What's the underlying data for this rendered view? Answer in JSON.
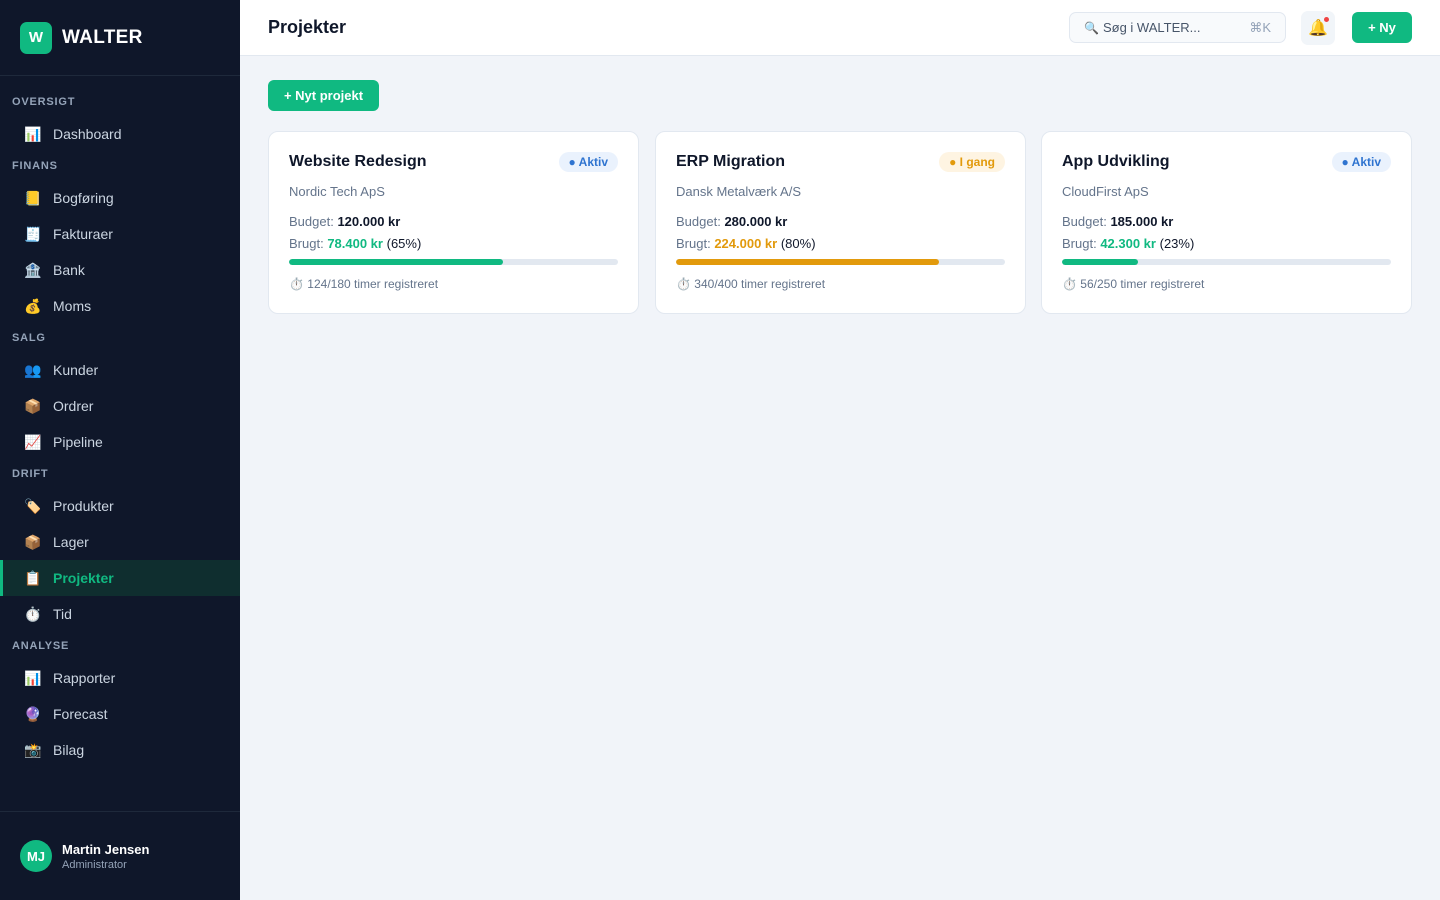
{
  "brand": {
    "logo_letter": "W",
    "name": "WALTER"
  },
  "sidebar": {
    "sections": [
      {
        "label": "OVERSIGT",
        "items": [
          {
            "label": "Dashboard",
            "icon": "📊",
            "icon_name": "chart-icon"
          }
        ]
      },
      {
        "label": "FINANS",
        "items": [
          {
            "label": "Bogføring",
            "icon": "📒",
            "icon_name": "ledger-icon"
          },
          {
            "label": "Fakturaer",
            "icon": "🧾",
            "icon_name": "receipt-icon"
          },
          {
            "label": "Bank",
            "icon": "🏦",
            "icon_name": "bank-icon"
          },
          {
            "label": "Moms",
            "icon": "💰",
            "icon_name": "money-bag-icon"
          }
        ]
      },
      {
        "label": "SALG",
        "items": [
          {
            "label": "Kunder",
            "icon": "👥",
            "icon_name": "users-icon"
          },
          {
            "label": "Ordrer",
            "icon": "📦",
            "icon_name": "package-icon"
          },
          {
            "label": "Pipeline",
            "icon": "📈",
            "icon_name": "trend-icon"
          }
        ]
      },
      {
        "label": "DRIFT",
        "items": [
          {
            "label": "Produkter",
            "icon": "🏷️",
            "icon_name": "tag-icon"
          },
          {
            "label": "Lager",
            "icon": "📦",
            "icon_name": "package-icon"
          },
          {
            "label": "Projekter",
            "icon": "📋",
            "icon_name": "clipboard-icon",
            "active": true
          },
          {
            "label": "Tid",
            "icon": "⏱️",
            "icon_name": "stopwatch-icon"
          }
        ]
      },
      {
        "label": "ANALYSE",
        "items": [
          {
            "label": "Rapporter",
            "icon": "📊",
            "icon_name": "chart-icon"
          },
          {
            "label": "Forecast",
            "icon": "🔮",
            "icon_name": "crystal-ball-icon"
          },
          {
            "label": "Bilag",
            "icon": "📸",
            "icon_name": "camera-icon"
          }
        ]
      }
    ]
  },
  "user": {
    "initials": "MJ",
    "name": "Martin Jensen",
    "role": "Administrator"
  },
  "header": {
    "title": "Projekter",
    "search_placeholder": "Søg i WALTER...",
    "search_shortcut": "⌘K",
    "new_label": "+ Ny"
  },
  "main": {
    "new_project_label": "+ Nyt projekt",
    "projects": [
      {
        "name": "Website Redesign",
        "status": "● Aktiv",
        "status_color": "blue",
        "client": "Nordic Tech ApS",
        "budget_label": "Budget:",
        "budget": "120.000 kr",
        "used_label": "Brugt:",
        "used": "78.400 kr",
        "used_pct": "(65%)",
        "progress": 0.65,
        "color": "#10b981",
        "hours": "124/180 timer registreret"
      },
      {
        "name": "ERP Migration",
        "status": "● I gang",
        "status_color": "amber",
        "client": "Dansk Metalværk A/S",
        "budget_label": "Budget:",
        "budget": "280.000 kr",
        "used_label": "Brugt:",
        "used": "224.000 kr",
        "used_pct": "(80%)",
        "progress": 0.8,
        "color": "#e29a0c",
        "hours": "340/400 timer registreret"
      },
      {
        "name": "App Udvikling",
        "status": "● Aktiv",
        "status_color": "blue",
        "client": "CloudFirst ApS",
        "budget_label": "Budget:",
        "budget": "185.000 kr",
        "used_label": "Brugt:",
        "used": "42.300 kr",
        "used_pct": "(23%)",
        "progress": 0.23,
        "color": "#10b981",
        "hours": "56/250 timer registreret"
      }
    ]
  }
}
